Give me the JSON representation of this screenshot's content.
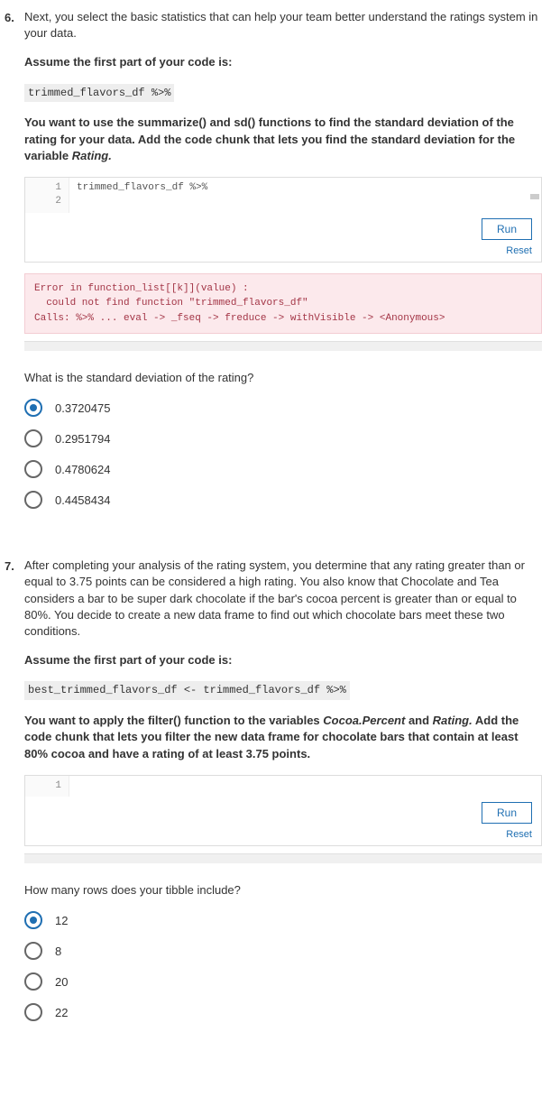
{
  "q6": {
    "number": "6.",
    "prompt": "Next, you select the basic statistics that can help your team better understand the ratings system in your data.",
    "assume_label": "Assume the first part of your code is:",
    "assume_code": "trimmed_flavors_df %>%",
    "instruction_pre": "You want to use the summarize() and sd() functions to find the standard deviation of the rating for your data. Add the code chunk that lets you find the standard deviation for the variable ",
    "instruction_var": "Rating.",
    "code_lines": [
      "1",
      "2"
    ],
    "code_content": "trimmed_flavors_df %>%",
    "run_label": "Run",
    "reset_label": "Reset",
    "error_text": "Error in function_list[[k]](value) :\n  could not find function \"trimmed_flavors_df\"\nCalls: %>% ... eval -> _fseq -> freduce -> withVisible -> <Anonymous>",
    "subquestion": "What is the standard deviation of the rating?",
    "options": [
      "0.3720475",
      "0.2951794",
      "0.4780624",
      "0.4458434"
    ],
    "selected": 0
  },
  "q7": {
    "number": "7.",
    "prompt": "After completing your analysis of the rating system, you determine that any rating greater than or equal to 3.75 points can be considered a high rating. You also know that Chocolate and Tea considers a bar to be super dark chocolate if the bar's cocoa percent is greater than or equal to 80%. You decide to create a new data frame to find out which chocolate bars meet these two conditions.",
    "assume_label": "Assume the first part of your code is:",
    "assume_code": "best_trimmed_flavors_df <- trimmed_flavors_df %>%",
    "instruction_pre": "You want to apply the filter() function to the variables ",
    "instruction_var1": "Cocoa.Percent",
    "instruction_mid": " and ",
    "instruction_var2": "Rating.",
    "instruction_post": " Add the code chunk that lets you filter the new data frame for chocolate bars that contain at least 80% cocoa and have a rating of at least 3.75 points.",
    "code_lines": [
      "1"
    ],
    "run_label": "Run",
    "reset_label": "Reset",
    "subquestion": "How many rows does your tibble include?",
    "options": [
      "12",
      "8",
      "20",
      "22"
    ],
    "selected": 0
  }
}
